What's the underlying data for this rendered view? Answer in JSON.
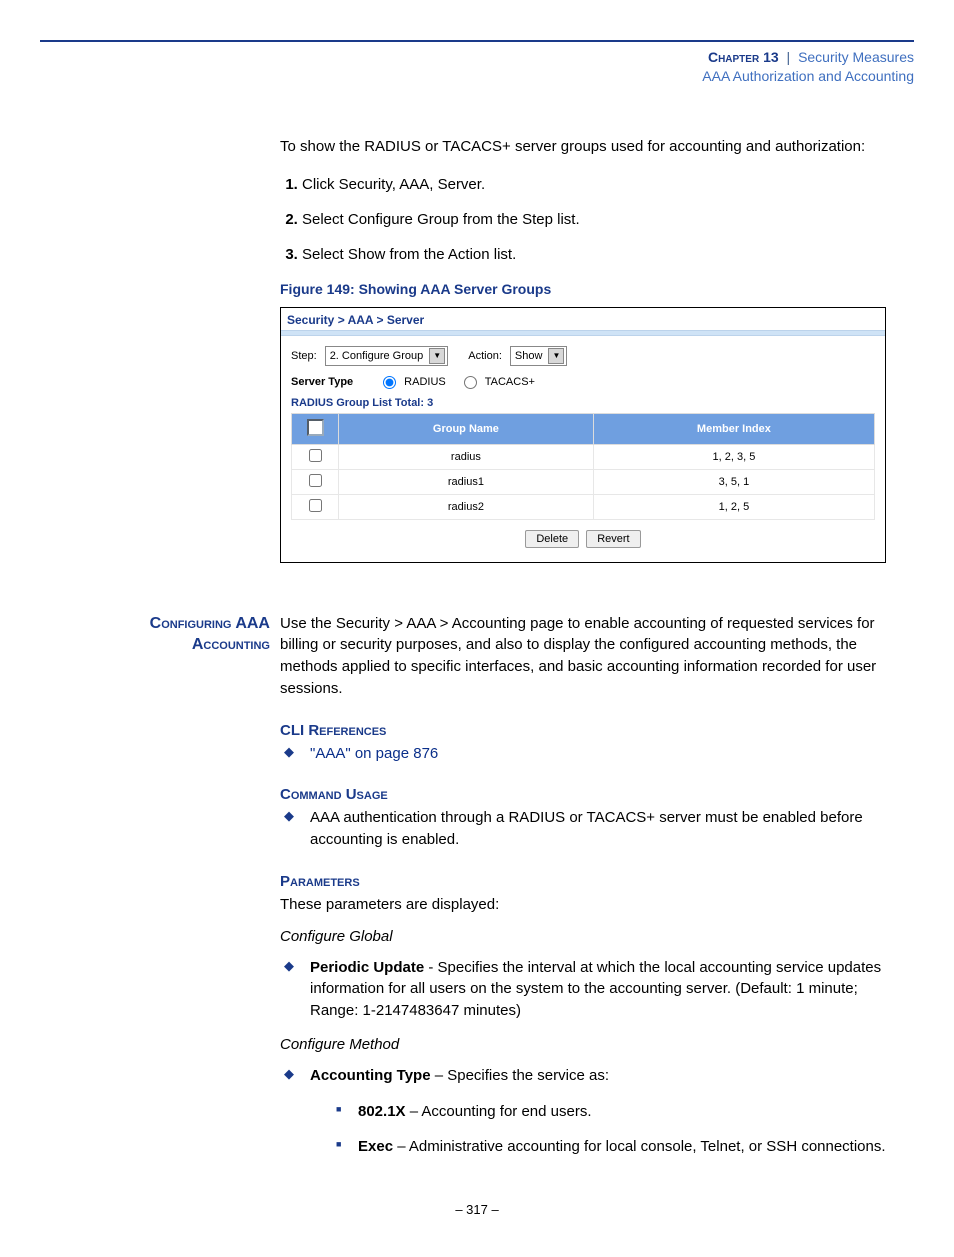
{
  "header": {
    "chapter": "Chapter 13",
    "separator": "|",
    "crumb": "Security Measures",
    "sub": "AAA Authorization and Accounting"
  },
  "intro": "To show the RADIUS or TACACS+ server groups used for accounting and authorization:",
  "steps": [
    "Click Security, AAA, Server.",
    "Select Configure Group from the Step list.",
    "Select Show from the Action list."
  ],
  "figure_caption": "Figure 149:  Showing AAA Server Groups",
  "app": {
    "breadcrumb": "Security > AAA > Server",
    "step_label": "Step:",
    "step_value": "2. Configure Group",
    "action_label": "Action:",
    "action_value": "Show",
    "server_type_label": "Server Type",
    "radio_radius": "RADIUS",
    "radio_tacacs": "TACACS+",
    "list_title": "RADIUS Group List",
    "list_total": "Total: 3",
    "col1": "Group Name",
    "col2": "Member Index",
    "rows": [
      {
        "name": "radius",
        "members": "1, 2, 3, 5"
      },
      {
        "name": "radius1",
        "members": "3, 5, 1"
      },
      {
        "name": "radius2",
        "members": "1, 2, 5"
      }
    ],
    "btn_delete": "Delete",
    "btn_revert": "Revert"
  },
  "section": {
    "side_title_l1": "Configuring AAA",
    "side_title_l2": "Accounting",
    "lead": "Use the Security > AAA > Accounting page to enable accounting of requested services for billing or security purposes, and also to display the configured accounting methods, the methods applied to specific interfaces, and basic accounting information recorded for user sessions.",
    "cli_ref_h": "CLI References",
    "cli_ref_link": "\"AAA\" on page 876",
    "cmd_usage_h": "Command Usage",
    "cmd_usage_item": "AAA authentication through a RADIUS or TACACS+ server must be enabled before accounting is enabled.",
    "params_h": "Parameters",
    "params_intro": "These parameters are displayed:",
    "cfg_global": "Configure Global",
    "periodic_bold": "Periodic Update",
    "periodic_rest": " - Specifies the interval at which the local accounting service updates information for all users on the system to the accounting server. (Default: 1 minute; Range: 1-2147483647 minutes)",
    "cfg_method": "Configure Method",
    "acct_type_bold": "Accounting Type",
    "acct_type_rest": " – Specifies the service as:",
    "sub_8021x_bold": "802.1X",
    "sub_8021x_rest": " – Accounting for end users.",
    "sub_exec_bold": "Exec",
    "sub_exec_rest": " – Administrative accounting for local console, Telnet, or SSH connections."
  },
  "pagenum": "–  317  –"
}
